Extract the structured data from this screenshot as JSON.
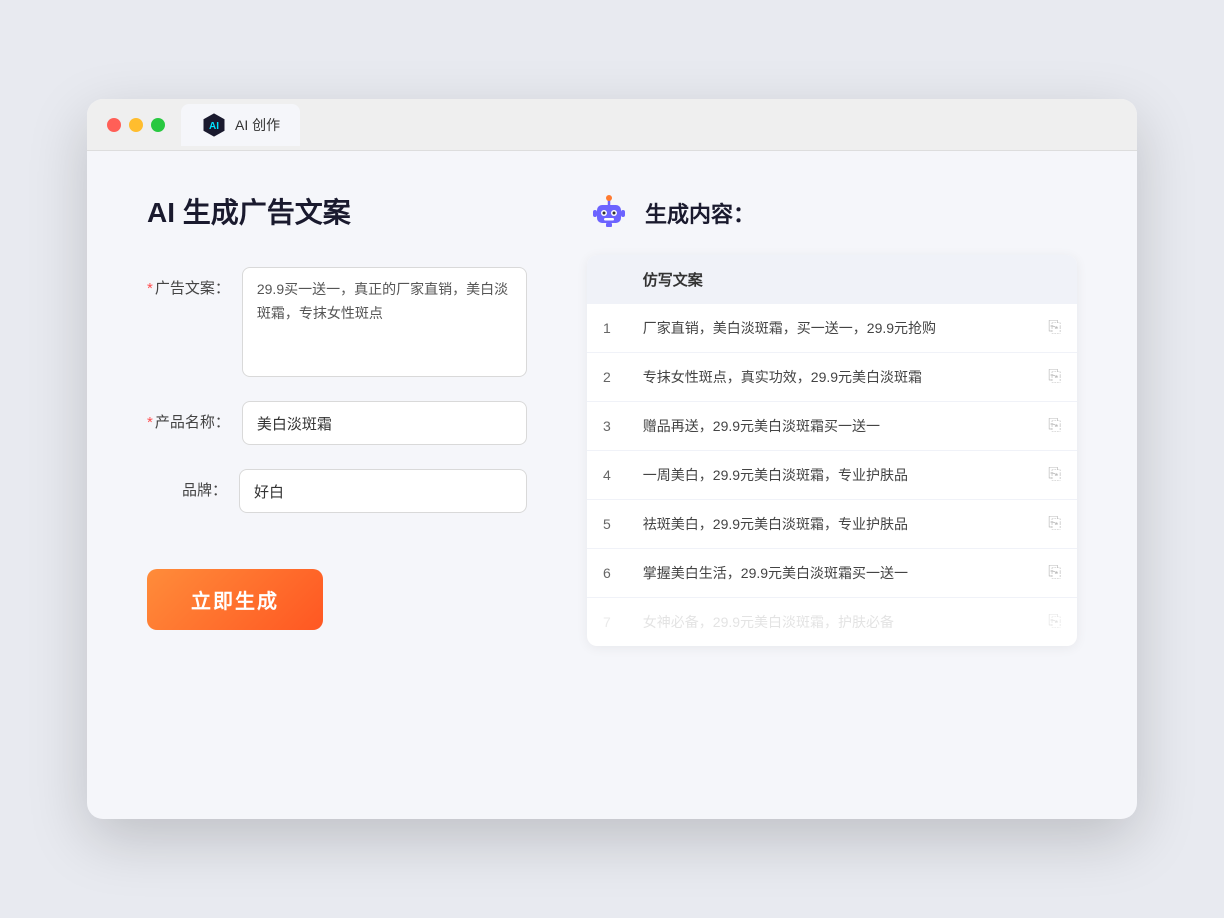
{
  "browser": {
    "tab_label": "AI 创作"
  },
  "left_panel": {
    "title": "AI 生成广告文案",
    "form": {
      "ad_copy_label": "广告文案：",
      "ad_copy_required": "*",
      "ad_copy_value": "29.9买一送一，真正的厂家直销，美白淡斑霜，专抹女性斑点",
      "product_name_label": "产品名称：",
      "product_name_required": "*",
      "product_name_value": "美白淡斑霜",
      "brand_label": "品牌：",
      "brand_value": "好白",
      "generate_button": "立即生成"
    }
  },
  "right_panel": {
    "result_title": "生成内容：",
    "table": {
      "column_header": "仿写文案",
      "rows": [
        {
          "num": "1",
          "text": "厂家直销，美白淡斑霜，买一送一，29.9元抢购",
          "faded": false
        },
        {
          "num": "2",
          "text": "专抹女性斑点，真实功效，29.9元美白淡斑霜",
          "faded": false
        },
        {
          "num": "3",
          "text": "赠品再送，29.9元美白淡斑霜买一送一",
          "faded": false
        },
        {
          "num": "4",
          "text": "一周美白，29.9元美白淡斑霜，专业护肤品",
          "faded": false
        },
        {
          "num": "5",
          "text": "祛斑美白，29.9元美白淡斑霜，专业护肤品",
          "faded": false
        },
        {
          "num": "6",
          "text": "掌握美白生活，29.9元美白淡斑霜买一送一",
          "faded": false
        },
        {
          "num": "7",
          "text": "女神必备，29.9元美白淡斑霜，护肤必备",
          "faded": true
        }
      ]
    }
  }
}
